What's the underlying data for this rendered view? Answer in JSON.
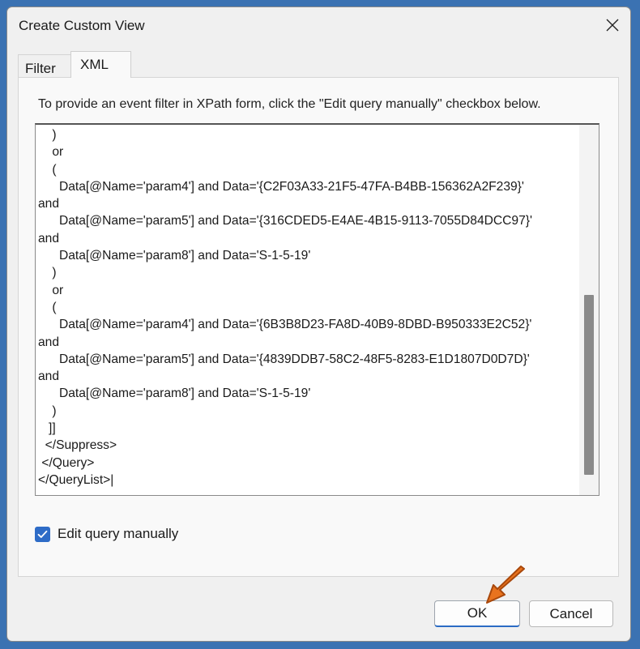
{
  "window": {
    "title": "Create Custom View"
  },
  "tabs": [
    {
      "label": "Filter"
    },
    {
      "label": "XML"
    }
  ],
  "info_text": "To provide an event filter in XPath form, click the \"Edit query manually\" checkbox below.",
  "xml_lines": [
    "    )",
    "    or",
    "    (",
    "      Data[@Name='param4'] and Data='{C2F03A33-21F5-47FA-B4BB-156362A2F239}'",
    "and",
    "      Data[@Name='param5'] and Data='{316CDED5-E4AE-4B15-9113-7055D84DCC97}'",
    "and",
    "      Data[@Name='param8'] and Data='S-1-5-19'",
    "    )",
    "    or",
    "    (",
    "      Data[@Name='param4'] and Data='{6B3B8D23-FA8D-40B9-8DBD-B950333E2C52}'",
    "and",
    "      Data[@Name='param5'] and Data='{4839DDB7-58C2-48F5-8283-E1D1807D0D7D}'",
    "and",
    "      Data[@Name='param8'] and Data='S-1-5-19'",
    "    )",
    "   ]]",
    "  </Suppress>",
    " </Query>",
    "</QueryList>|"
  ],
  "checkbox": {
    "label": "Edit query manually",
    "checked": true
  },
  "buttons": {
    "ok": "OK",
    "cancel": "Cancel"
  },
  "colors": {
    "background": "#3b72b2",
    "dialog": "#f0f0f0",
    "accent": "#2e6cc7",
    "arrow": "#e8731e"
  }
}
